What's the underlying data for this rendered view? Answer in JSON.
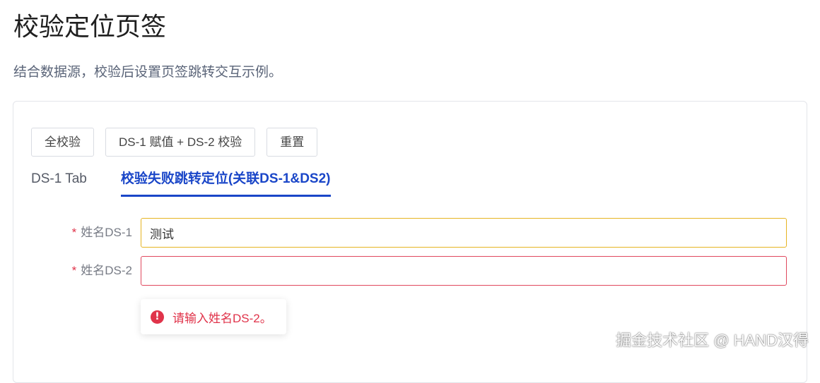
{
  "page": {
    "title": "校验定位页签",
    "description": "结合数据源，校验后设置页签跳转交互示例。"
  },
  "toolbar": {
    "validate_all_label": "全校验",
    "assign_validate_label": "DS-1 赋值 + DS-2 校验",
    "reset_label": "重置"
  },
  "tabs": [
    {
      "label": "DS-1 Tab",
      "active": false
    },
    {
      "label": "校验失败跳转定位(关联DS-1&DS2)",
      "active": true
    }
  ],
  "form": {
    "required_mark": "*",
    "fields": [
      {
        "label": "姓名DS-1",
        "value": "测试",
        "placeholder": ""
      },
      {
        "label": "姓名DS-2",
        "value": "",
        "placeholder": ""
      }
    ],
    "error_icon": "exclamation-circle-icon",
    "error_message": "请输入姓名DS-2。"
  },
  "watermark": "掘金技术社区 @ HAND汉得",
  "colors": {
    "accent": "#1a46c8",
    "error": "#e0334a",
    "warning_border": "#e6b422"
  }
}
